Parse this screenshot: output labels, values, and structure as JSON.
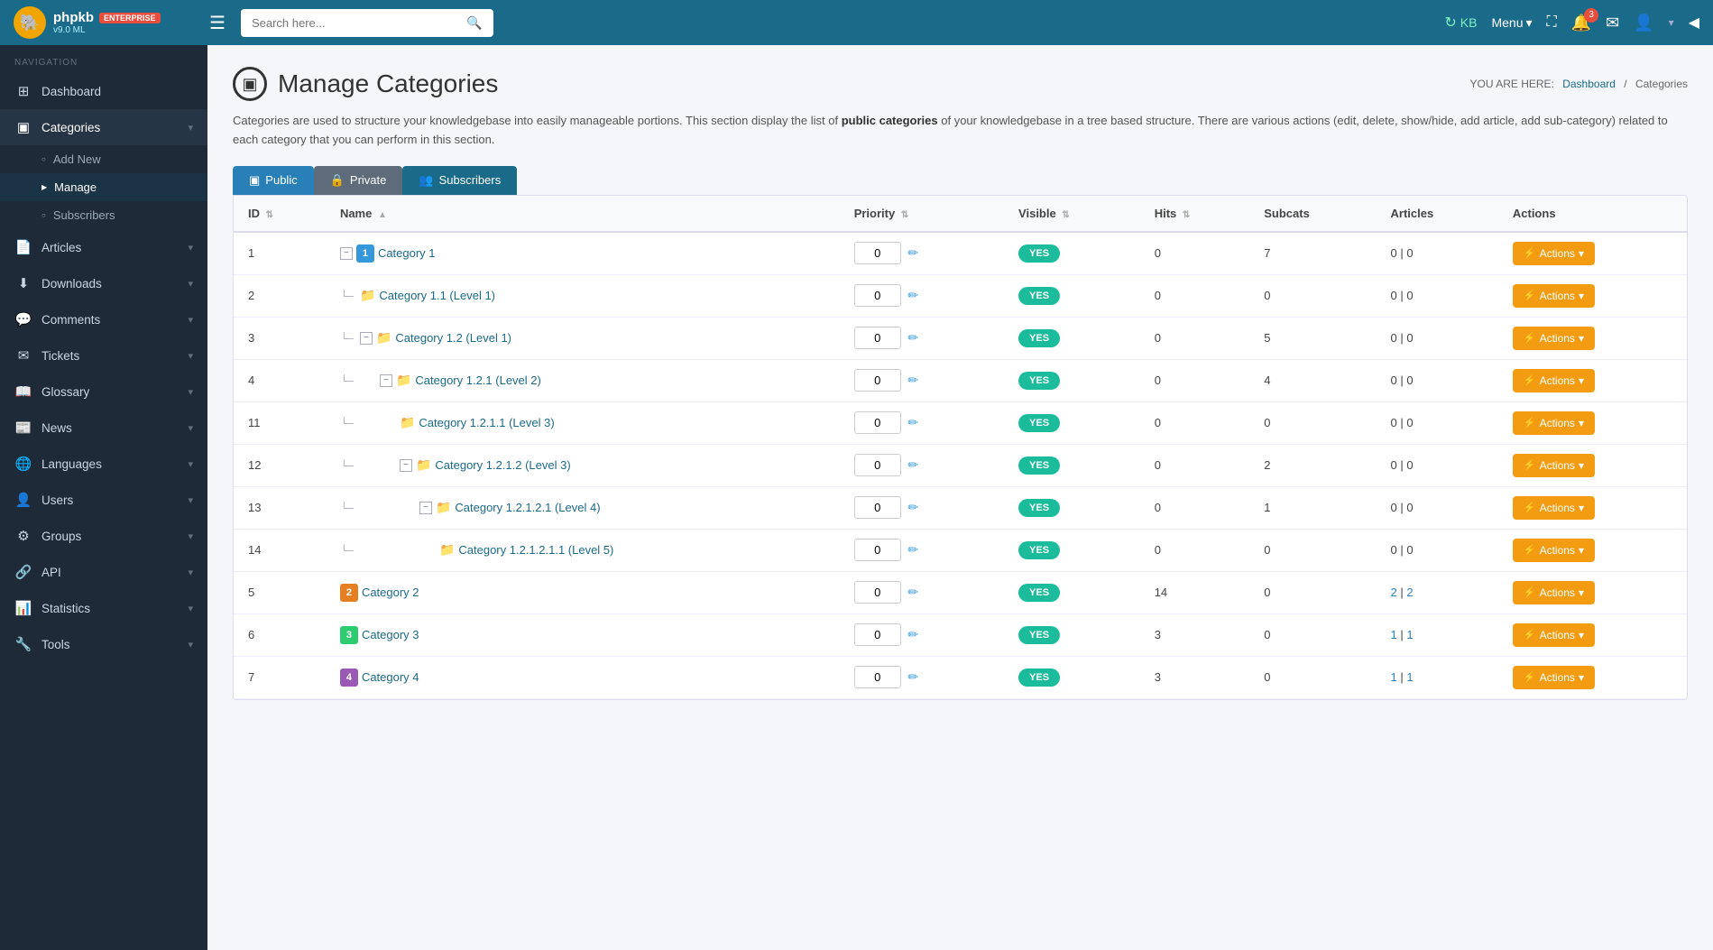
{
  "topbar": {
    "logo_icon": "🐘",
    "logo_text": "phpkb",
    "logo_enterprise": "ENTERPRISE",
    "logo_version": "v9.0 ML",
    "search_placeholder": "Search here...",
    "kb_label": "KB",
    "menu_label": "Menu",
    "notification_count": "3"
  },
  "sidebar": {
    "nav_label": "NAVIGATION",
    "items": [
      {
        "id": "dashboard",
        "label": "Dashboard",
        "icon": "⊞",
        "has_children": false
      },
      {
        "id": "categories",
        "label": "Categories",
        "icon": "▣",
        "has_children": true,
        "active": true,
        "children": [
          {
            "id": "add-new",
            "label": "Add New"
          },
          {
            "id": "manage",
            "label": "Manage",
            "active": true
          },
          {
            "id": "subscribers",
            "label": "Subscribers"
          }
        ]
      },
      {
        "id": "articles",
        "label": "Articles",
        "icon": "📄",
        "has_children": true
      },
      {
        "id": "downloads",
        "label": "Downloads",
        "icon": "⬇",
        "has_children": true
      },
      {
        "id": "comments",
        "label": "Comments",
        "icon": "💬",
        "has_children": true
      },
      {
        "id": "tickets",
        "label": "Tickets",
        "icon": "✉",
        "has_children": true
      },
      {
        "id": "glossary",
        "label": "Glossary",
        "icon": "📖",
        "has_children": true
      },
      {
        "id": "news",
        "label": "News",
        "icon": "📰",
        "has_children": true
      },
      {
        "id": "languages",
        "label": "Languages",
        "icon": "🌐",
        "has_children": true
      },
      {
        "id": "users",
        "label": "Users",
        "icon": "👤",
        "has_children": true
      },
      {
        "id": "groups",
        "label": "Groups",
        "icon": "⚙",
        "has_children": true
      },
      {
        "id": "api",
        "label": "API",
        "icon": "🔗",
        "has_children": true
      },
      {
        "id": "statistics",
        "label": "Statistics",
        "icon": "📊",
        "has_children": true
      },
      {
        "id": "tools",
        "label": "Tools",
        "icon": "🔧",
        "has_children": true
      }
    ]
  },
  "page": {
    "title": "Manage Categories",
    "breadcrumb_you_are_here": "YOU ARE HERE:",
    "breadcrumb_dashboard": "Dashboard",
    "breadcrumb_separator": "/",
    "breadcrumb_current": "Categories",
    "description": "Categories are used to structure your knowledgebase into easily manageable portions. This section display the list of ",
    "description_bold": "public categories",
    "description_rest": " of your knowledgebase in a tree based structure. There are various actions (edit, delete, show/hide, add article, add sub-category) related to each category that you can perform in this section."
  },
  "tabs": [
    {
      "id": "public",
      "label": "Public",
      "icon": "▣",
      "type": "public"
    },
    {
      "id": "private",
      "label": "Private",
      "icon": "🔒",
      "type": "private"
    },
    {
      "id": "subscribers",
      "label": "Subscribers",
      "icon": "👥",
      "type": "subscribers"
    }
  ],
  "table": {
    "columns": [
      {
        "id": "id",
        "label": "ID",
        "sortable": true
      },
      {
        "id": "name",
        "label": "Name",
        "sortable": true
      },
      {
        "id": "priority",
        "label": "Priority",
        "sortable": true
      },
      {
        "id": "visible",
        "label": "Visible",
        "sortable": true
      },
      {
        "id": "hits",
        "label": "Hits",
        "sortable": true
      },
      {
        "id": "subcats",
        "label": "Subcats",
        "sortable": false
      },
      {
        "id": "articles",
        "label": "Articles",
        "sortable": false
      },
      {
        "id": "actions",
        "label": "Actions",
        "sortable": false
      }
    ],
    "rows": [
      {
        "id": "1",
        "name": "Category 1",
        "level": 0,
        "indent": 0,
        "badge": "1",
        "badge_class": "badge-1",
        "has_collapse": true,
        "has_folder": false,
        "priority": "0",
        "visible": "YES",
        "hits": "0",
        "subcats": "7",
        "articles": "0 | 0",
        "articles_link": false
      },
      {
        "id": "2",
        "name": "Category 1.1 (Level 1)",
        "level": 1,
        "indent": 1,
        "badge": null,
        "has_collapse": false,
        "has_folder": true,
        "priority": "0",
        "visible": "YES",
        "hits": "0",
        "subcats": "0",
        "articles": "0 | 0",
        "articles_link": false
      },
      {
        "id": "3",
        "name": "Category 1.2 (Level 1)",
        "level": 1,
        "indent": 1,
        "badge": null,
        "has_collapse": true,
        "has_folder": true,
        "priority": "0",
        "visible": "YES",
        "hits": "0",
        "subcats": "5",
        "articles": "0 | 0",
        "articles_link": false
      },
      {
        "id": "4",
        "name": "Category 1.2.1 (Level 2)",
        "level": 2,
        "indent": 2,
        "badge": null,
        "has_collapse": true,
        "has_folder": true,
        "priority": "0",
        "visible": "YES",
        "hits": "0",
        "subcats": "4",
        "articles": "0 | 0",
        "articles_link": false
      },
      {
        "id": "11",
        "name": "Category 1.2.1.1 (Level 3)",
        "level": 3,
        "indent": 3,
        "badge": null,
        "has_collapse": false,
        "has_folder": true,
        "priority": "0",
        "visible": "YES",
        "hits": "0",
        "subcats": "0",
        "articles": "0 | 0",
        "articles_link": false
      },
      {
        "id": "12",
        "name": "Category 1.2.1.2 (Level 3)",
        "level": 3,
        "indent": 3,
        "badge": null,
        "has_collapse": true,
        "has_folder": true,
        "priority": "0",
        "visible": "YES",
        "hits": "0",
        "subcats": "2",
        "articles": "0 | 0",
        "articles_link": false
      },
      {
        "id": "13",
        "name": "Category 1.2.1.2.1 (Level 4)",
        "level": 4,
        "indent": 4,
        "badge": null,
        "has_collapse": true,
        "has_folder": true,
        "priority": "0",
        "visible": "YES",
        "hits": "0",
        "subcats": "1",
        "articles": "0 | 0",
        "articles_link": false
      },
      {
        "id": "14",
        "name": "Category 1.2.1.2.1.1 (Level 5)",
        "level": 5,
        "indent": 5,
        "badge": null,
        "has_collapse": false,
        "has_folder": true,
        "priority": "0",
        "visible": "YES",
        "hits": "0",
        "subcats": "0",
        "articles": "0 | 0",
        "articles_link": false
      },
      {
        "id": "5",
        "name": "Category 2",
        "level": 0,
        "indent": 0,
        "badge": "2",
        "badge_class": "badge-2",
        "has_collapse": false,
        "has_folder": false,
        "priority": "0",
        "visible": "YES",
        "hits": "14",
        "subcats": "0",
        "articles": "2 | 2",
        "articles_link": true
      },
      {
        "id": "6",
        "name": "Category 3",
        "level": 0,
        "indent": 0,
        "badge": "3",
        "badge_class": "badge-3",
        "has_collapse": false,
        "has_folder": false,
        "priority": "0",
        "visible": "YES",
        "hits": "3",
        "subcats": "0",
        "articles": "1 | 1",
        "articles_link": true
      },
      {
        "id": "7",
        "name": "Category 4",
        "level": 0,
        "indent": 0,
        "badge": "4",
        "badge_class": "badge-4",
        "has_collapse": false,
        "has_folder": false,
        "priority": "0",
        "visible": "YES",
        "hits": "3",
        "subcats": "0",
        "articles": "1 | 1",
        "articles_link": true
      }
    ],
    "actions_label": "⚡ Actions ▾"
  }
}
